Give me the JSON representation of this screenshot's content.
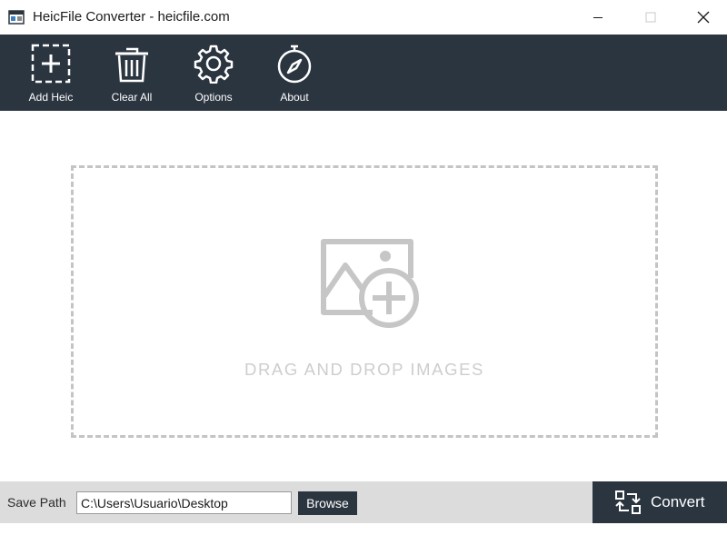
{
  "window": {
    "title": "HeicFile Converter - heicfile.com",
    "icons": {
      "app": "app-icon",
      "minimize": "minimize-icon",
      "maximize": "maximize-icon",
      "close": "close-icon"
    }
  },
  "toolbar": {
    "items": [
      {
        "label": "Add Heic",
        "icon": "add-square-icon"
      },
      {
        "label": "Clear All",
        "icon": "trash-icon"
      },
      {
        "label": "Options",
        "icon": "gear-icon"
      },
      {
        "label": "About",
        "icon": "compass-icon"
      }
    ]
  },
  "dropzone": {
    "text": "DRAG AND DROP IMAGES",
    "icon": "image-add-icon"
  },
  "bottom": {
    "save_path_label": "Save Path",
    "save_path_value": "C:\\Users\\Usuario\\Desktop",
    "browse_label": "Browse",
    "convert_label": "Convert",
    "convert_icon": "convert-icon"
  },
  "colors": {
    "toolbar_bg": "#2b3540",
    "bottom_bg": "#dcdcdc",
    "dropzone_border": "#c4c4c4",
    "dropzone_text": "#cdcdcd"
  }
}
